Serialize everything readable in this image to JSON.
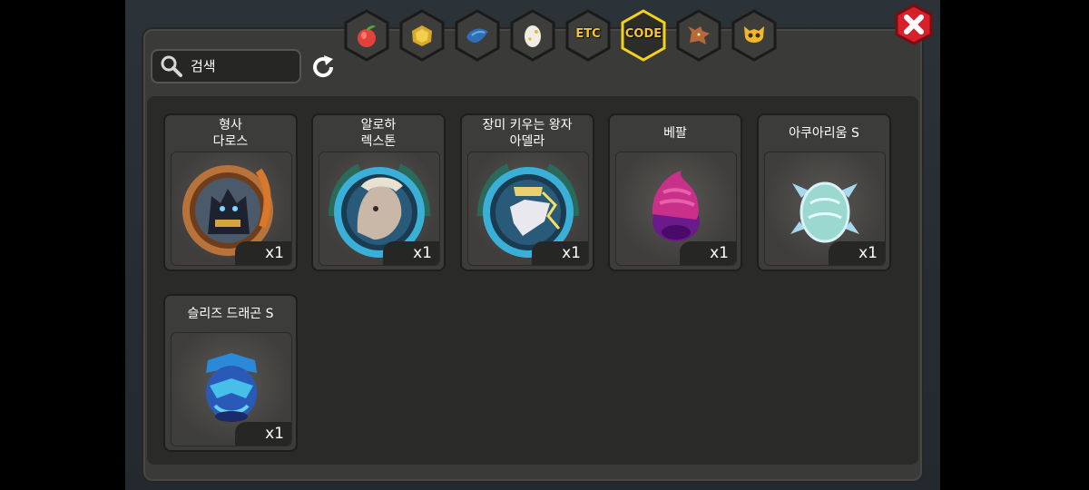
{
  "search": {
    "placeholder": "검색"
  },
  "tabs": [
    {
      "id": "fruit",
      "label": ""
    },
    {
      "id": "gold",
      "label": ""
    },
    {
      "id": "fish",
      "label": ""
    },
    {
      "id": "egg",
      "label": ""
    },
    {
      "id": "etc",
      "label": "ETC"
    },
    {
      "id": "code",
      "label": "CODE",
      "selected": true
    },
    {
      "id": "dragon",
      "label": ""
    },
    {
      "id": "mask",
      "label": ""
    }
  ],
  "items": [
    {
      "name": "형사\n다로스",
      "qty": "x1",
      "icon": "dragon-medal-bronze"
    },
    {
      "name": "알로하\n렉스톤",
      "qty": "x1",
      "icon": "dragon-medal-teal-rex"
    },
    {
      "name": "장미 키우는 왕자\n아델라",
      "qty": "x1",
      "icon": "dragon-medal-teal-prince"
    },
    {
      "name": "베팔",
      "qty": "x1",
      "icon": "purple-egg"
    },
    {
      "name": "아쿠아리움 S",
      "qty": "x1",
      "icon": "aqua-egg"
    },
    {
      "name": "슬리즈 드래곤 S",
      "qty": "x1",
      "icon": "blue-dragon-egg"
    }
  ],
  "colors": {
    "selected_tab_border": "#f4d21a",
    "close_red": "#d8202a",
    "text": "#ffffff"
  }
}
